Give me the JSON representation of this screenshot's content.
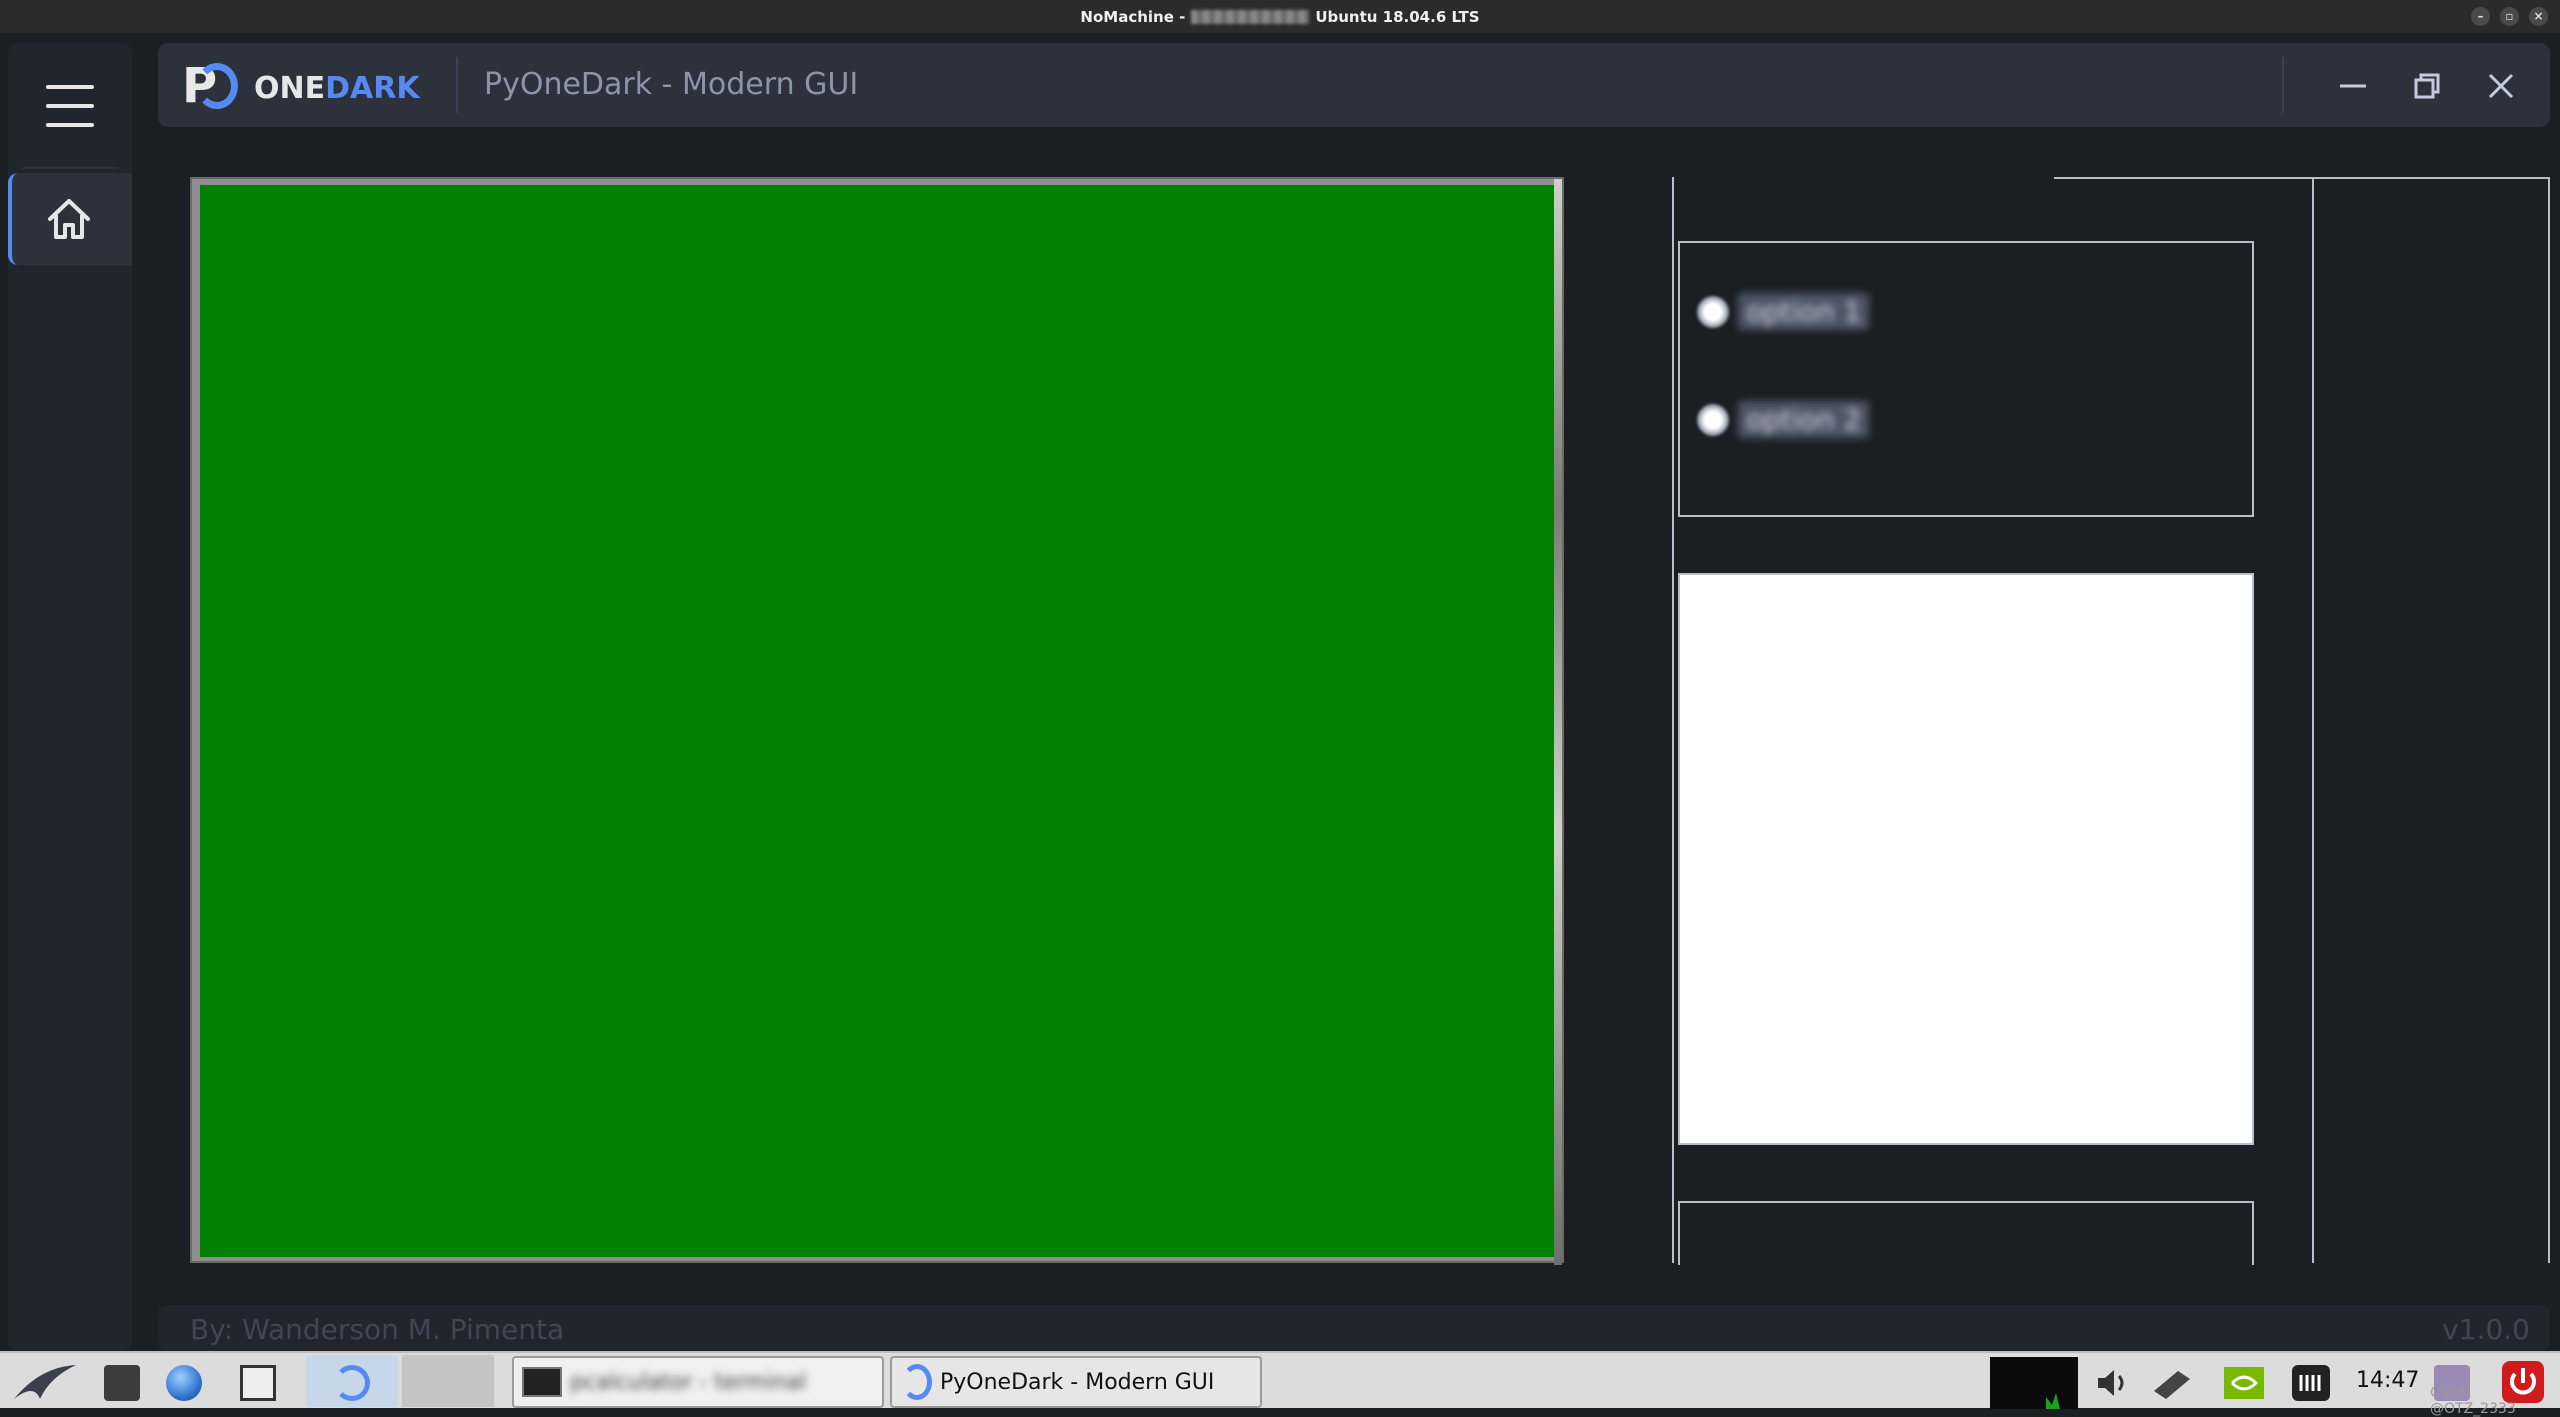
{
  "remote_window": {
    "title_prefix": "NoMachine - ",
    "title_suffix": "Ubuntu 18.04.6 LTS"
  },
  "app": {
    "logo_text_white": "ONE",
    "logo_text_accent": "DARK",
    "logo_prefix": "P",
    "title": "PyOneDark - Modern GUI",
    "credits": "By: Wanderson M. Pimenta",
    "version": "v1.0.0"
  },
  "colors": {
    "background": "#1b1e23",
    "panel": "#2c313c",
    "menu": "#21252d",
    "accent": "#568af2",
    "viewer_fill": "#008000"
  },
  "right_panel": {
    "radio_options": [
      "option 1",
      "option 2"
    ]
  },
  "taskbar": {
    "task_1": "pcalculator - terminal",
    "task_2": "PyOneDark - Modern GUI",
    "clock": "14:47",
    "watermark": "CSDN @OTZ_2333"
  },
  "icons": {
    "menu": "hamburger-icon",
    "home": "home-icon",
    "minimize": "minimize-icon",
    "maximize": "maximize-icon",
    "close": "close-icon"
  }
}
